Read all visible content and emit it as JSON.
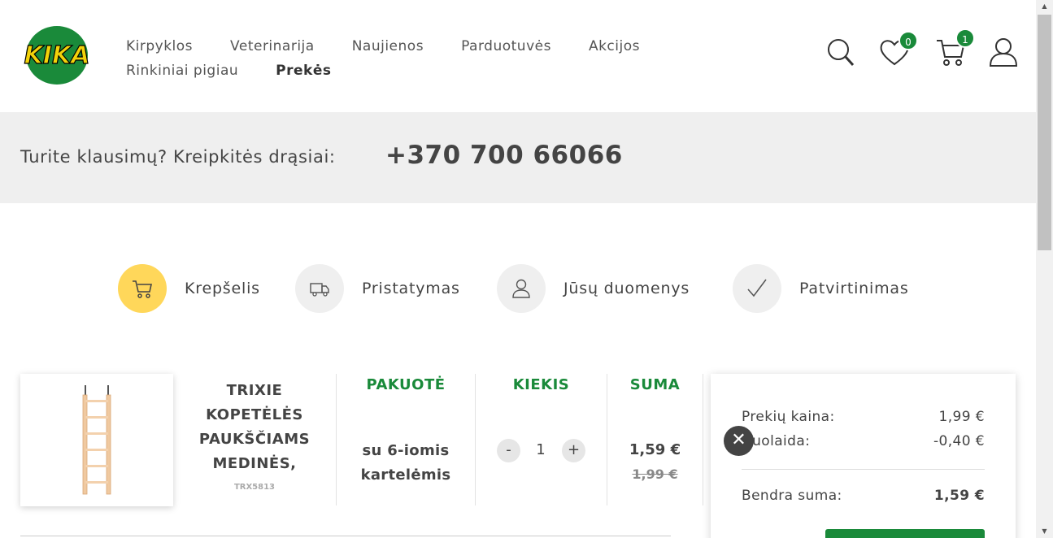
{
  "header": {
    "logo_text": "KIKA",
    "nav_row1": [
      "Kirpyklos",
      "Veterinarija",
      "Naujienos",
      "Parduotuvės",
      "Akcijos"
    ],
    "nav_row2": [
      "Rinkiniai pigiau",
      "Prekės"
    ],
    "wishlist_count": "0",
    "cart_count": "1"
  },
  "band": {
    "question": "Turite klausimų? Kreipkitės drąsiai:",
    "phone": "+370 700 66066"
  },
  "steps": [
    {
      "label": "Krepšelis",
      "icon": "cart-icon",
      "active": true
    },
    {
      "label": "Pristatymas",
      "icon": "truck-icon",
      "active": false
    },
    {
      "label": "Jūsų duomenys",
      "icon": "user-icon",
      "active": false
    },
    {
      "label": "Patvirtinimas",
      "icon": "check-icon",
      "active": false
    }
  ],
  "item": {
    "name": "TRIXIE KOPETĖLĖS PAUKŠČIAMS MEDINĖS,",
    "sku": "TRX5813",
    "col_package": "PAKUOTĖ",
    "col_quantity": "KIEKIS",
    "col_sum": "SUMA",
    "package": "su 6-iomis kartelėmis",
    "minus": "-",
    "plus": "+",
    "quantity": "1",
    "price": "1,59 €",
    "old_price": "1,99 €"
  },
  "summary": {
    "items_price_label": "Prekių kaina:",
    "items_price": "1,99 €",
    "discount_label": "Nuolaida:",
    "discount": "-0,40 €",
    "total_label": "Bendra suma:",
    "total": "1,59 €"
  },
  "colors": {
    "brand_green": "#1a8a3a",
    "active_step": "#ffd75a",
    "logo_yellow": "#f2d20a"
  }
}
